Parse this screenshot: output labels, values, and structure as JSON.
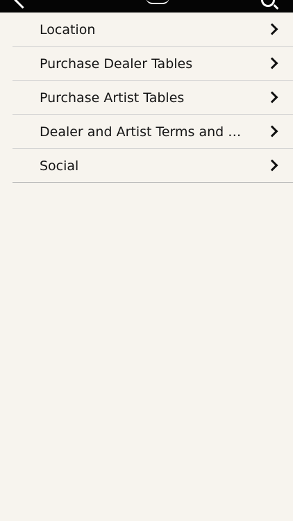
{
  "menu": {
    "items": [
      {
        "label": "Location",
        "icon": "chevron-right-icon"
      },
      {
        "label": "Purchase Dealer Tables",
        "icon": "chevron-right-icon"
      },
      {
        "label": "Purchase Artist Tables",
        "icon": "chevron-right-icon"
      },
      {
        "label": "Dealer and Artist Terms and Conditions",
        "icon": "chevron-right-icon"
      },
      {
        "label": "Social",
        "icon": "chevron-right-icon"
      }
    ]
  },
  "header": {
    "back_icon": "back-chevron-icon",
    "search_icon": "search-icon"
  },
  "colors": {
    "background": "#f7f4ee",
    "header": "#050505",
    "text": "#141414",
    "divider": "#cfcfcf"
  }
}
